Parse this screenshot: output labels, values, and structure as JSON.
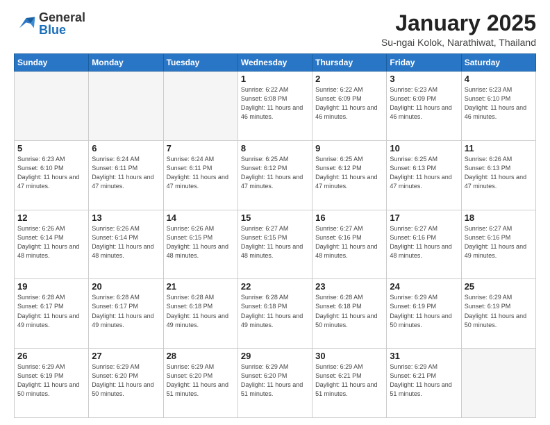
{
  "header": {
    "logo_general": "General",
    "logo_blue": "Blue",
    "month": "January 2025",
    "location": "Su-ngai Kolok, Narathiwat, Thailand"
  },
  "weekdays": [
    "Sunday",
    "Monday",
    "Tuesday",
    "Wednesday",
    "Thursday",
    "Friday",
    "Saturday"
  ],
  "weeks": [
    [
      {
        "day": "",
        "info": ""
      },
      {
        "day": "",
        "info": ""
      },
      {
        "day": "",
        "info": ""
      },
      {
        "day": "1",
        "info": "Sunrise: 6:22 AM\nSunset: 6:08 PM\nDaylight: 11 hours\nand 46 minutes."
      },
      {
        "day": "2",
        "info": "Sunrise: 6:22 AM\nSunset: 6:09 PM\nDaylight: 11 hours\nand 46 minutes."
      },
      {
        "day": "3",
        "info": "Sunrise: 6:23 AM\nSunset: 6:09 PM\nDaylight: 11 hours\nand 46 minutes."
      },
      {
        "day": "4",
        "info": "Sunrise: 6:23 AM\nSunset: 6:10 PM\nDaylight: 11 hours\nand 46 minutes."
      }
    ],
    [
      {
        "day": "5",
        "info": "Sunrise: 6:23 AM\nSunset: 6:10 PM\nDaylight: 11 hours\nand 47 minutes."
      },
      {
        "day": "6",
        "info": "Sunrise: 6:24 AM\nSunset: 6:11 PM\nDaylight: 11 hours\nand 47 minutes."
      },
      {
        "day": "7",
        "info": "Sunrise: 6:24 AM\nSunset: 6:11 PM\nDaylight: 11 hours\nand 47 minutes."
      },
      {
        "day": "8",
        "info": "Sunrise: 6:25 AM\nSunset: 6:12 PM\nDaylight: 11 hours\nand 47 minutes."
      },
      {
        "day": "9",
        "info": "Sunrise: 6:25 AM\nSunset: 6:12 PM\nDaylight: 11 hours\nand 47 minutes."
      },
      {
        "day": "10",
        "info": "Sunrise: 6:25 AM\nSunset: 6:13 PM\nDaylight: 11 hours\nand 47 minutes."
      },
      {
        "day": "11",
        "info": "Sunrise: 6:26 AM\nSunset: 6:13 PM\nDaylight: 11 hours\nand 47 minutes."
      }
    ],
    [
      {
        "day": "12",
        "info": "Sunrise: 6:26 AM\nSunset: 6:14 PM\nDaylight: 11 hours\nand 48 minutes."
      },
      {
        "day": "13",
        "info": "Sunrise: 6:26 AM\nSunset: 6:14 PM\nDaylight: 11 hours\nand 48 minutes."
      },
      {
        "day": "14",
        "info": "Sunrise: 6:26 AM\nSunset: 6:15 PM\nDaylight: 11 hours\nand 48 minutes."
      },
      {
        "day": "15",
        "info": "Sunrise: 6:27 AM\nSunset: 6:15 PM\nDaylight: 11 hours\nand 48 minutes."
      },
      {
        "day": "16",
        "info": "Sunrise: 6:27 AM\nSunset: 6:16 PM\nDaylight: 11 hours\nand 48 minutes."
      },
      {
        "day": "17",
        "info": "Sunrise: 6:27 AM\nSunset: 6:16 PM\nDaylight: 11 hours\nand 48 minutes."
      },
      {
        "day": "18",
        "info": "Sunrise: 6:27 AM\nSunset: 6:16 PM\nDaylight: 11 hours\nand 49 minutes."
      }
    ],
    [
      {
        "day": "19",
        "info": "Sunrise: 6:28 AM\nSunset: 6:17 PM\nDaylight: 11 hours\nand 49 minutes."
      },
      {
        "day": "20",
        "info": "Sunrise: 6:28 AM\nSunset: 6:17 PM\nDaylight: 11 hours\nand 49 minutes."
      },
      {
        "day": "21",
        "info": "Sunrise: 6:28 AM\nSunset: 6:18 PM\nDaylight: 11 hours\nand 49 minutes."
      },
      {
        "day": "22",
        "info": "Sunrise: 6:28 AM\nSunset: 6:18 PM\nDaylight: 11 hours\nand 49 minutes."
      },
      {
        "day": "23",
        "info": "Sunrise: 6:28 AM\nSunset: 6:18 PM\nDaylight: 11 hours\nand 50 minutes."
      },
      {
        "day": "24",
        "info": "Sunrise: 6:29 AM\nSunset: 6:19 PM\nDaylight: 11 hours\nand 50 minutes."
      },
      {
        "day": "25",
        "info": "Sunrise: 6:29 AM\nSunset: 6:19 PM\nDaylight: 11 hours\nand 50 minutes."
      }
    ],
    [
      {
        "day": "26",
        "info": "Sunrise: 6:29 AM\nSunset: 6:19 PM\nDaylight: 11 hours\nand 50 minutes."
      },
      {
        "day": "27",
        "info": "Sunrise: 6:29 AM\nSunset: 6:20 PM\nDaylight: 11 hours\nand 50 minutes."
      },
      {
        "day": "28",
        "info": "Sunrise: 6:29 AM\nSunset: 6:20 PM\nDaylight: 11 hours\nand 51 minutes."
      },
      {
        "day": "29",
        "info": "Sunrise: 6:29 AM\nSunset: 6:20 PM\nDaylight: 11 hours\nand 51 minutes."
      },
      {
        "day": "30",
        "info": "Sunrise: 6:29 AM\nSunset: 6:21 PM\nDaylight: 11 hours\nand 51 minutes."
      },
      {
        "day": "31",
        "info": "Sunrise: 6:29 AM\nSunset: 6:21 PM\nDaylight: 11 hours\nand 51 minutes."
      },
      {
        "day": "",
        "info": ""
      }
    ]
  ]
}
